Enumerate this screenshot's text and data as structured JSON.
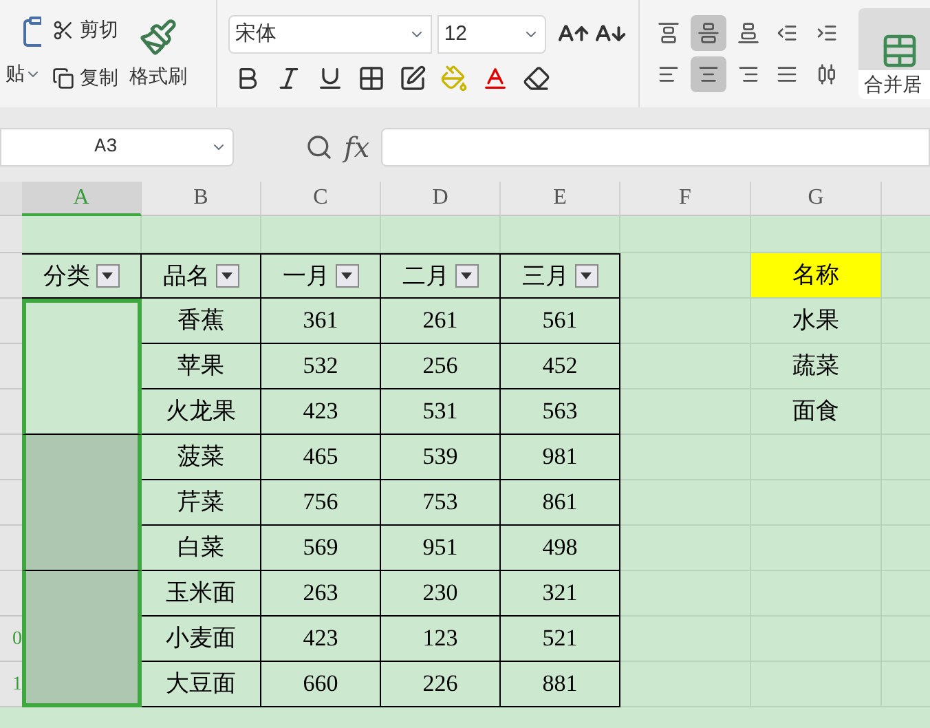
{
  "ribbon": {
    "clipboard": {
      "paste_label": "贴",
      "cut_label": "剪切",
      "copy_label": "复制",
      "format_painter_label": "格式刷"
    },
    "font": {
      "name": "宋体",
      "size": "12"
    },
    "alignment_buttons": [
      {
        "kind": "top",
        "selected": false
      },
      {
        "kind": "middle",
        "selected": true
      },
      {
        "kind": "bottom",
        "selected": false
      },
      {
        "kind": "outdent",
        "selected": false
      },
      {
        "kind": "indent",
        "selected": false
      },
      {
        "kind": "left",
        "selected": false
      },
      {
        "kind": "center",
        "selected": true
      },
      {
        "kind": "right",
        "selected": false
      },
      {
        "kind": "justify",
        "selected": false
      },
      {
        "kind": "distribute",
        "selected": false
      }
    ],
    "merge_label": "合并居"
  },
  "name_box": {
    "value": "A3"
  },
  "formula_bar": {
    "label": "fx"
  },
  "sheet": {
    "columns": [
      {
        "label": "A",
        "selected": true
      },
      {
        "label": "B",
        "selected": false
      },
      {
        "label": "C",
        "selected": false
      },
      {
        "label": "D",
        "selected": false
      },
      {
        "label": "E",
        "selected": false
      },
      {
        "label": "F",
        "selected": false
      },
      {
        "label": "G",
        "selected": false
      }
    ],
    "last_row_numbers": [
      "0",
      "1"
    ],
    "table": {
      "headers": [
        "分类",
        "品名",
        "一月",
        "二月",
        "三月"
      ],
      "groups": [
        {
          "active": true
        },
        {
          "active": false
        },
        {
          "active": false
        }
      ],
      "rows": [
        {
          "name": "香蕉",
          "values": [
            "361",
            "261",
            "561"
          ]
        },
        {
          "name": "苹果",
          "values": [
            "532",
            "256",
            "452"
          ]
        },
        {
          "name": "火龙果",
          "values": [
            "423",
            "531",
            "563"
          ]
        },
        {
          "name": "菠菜",
          "values": [
            "465",
            "539",
            "981"
          ]
        },
        {
          "name": "芹菜",
          "values": [
            "756",
            "753",
            "861"
          ]
        },
        {
          "name": "白菜",
          "values": [
            "569",
            "951",
            "498"
          ]
        },
        {
          "name": "玉米面",
          "values": [
            "263",
            "230",
            "321"
          ]
        },
        {
          "name": "小麦面",
          "values": [
            "423",
            "123",
            "521"
          ]
        },
        {
          "name": "大豆面",
          "values": [
            "660",
            "226",
            "881"
          ]
        }
      ]
    },
    "lookup": {
      "header": "名称",
      "items": [
        "水果",
        "蔬菜",
        "面食"
      ]
    }
  }
}
